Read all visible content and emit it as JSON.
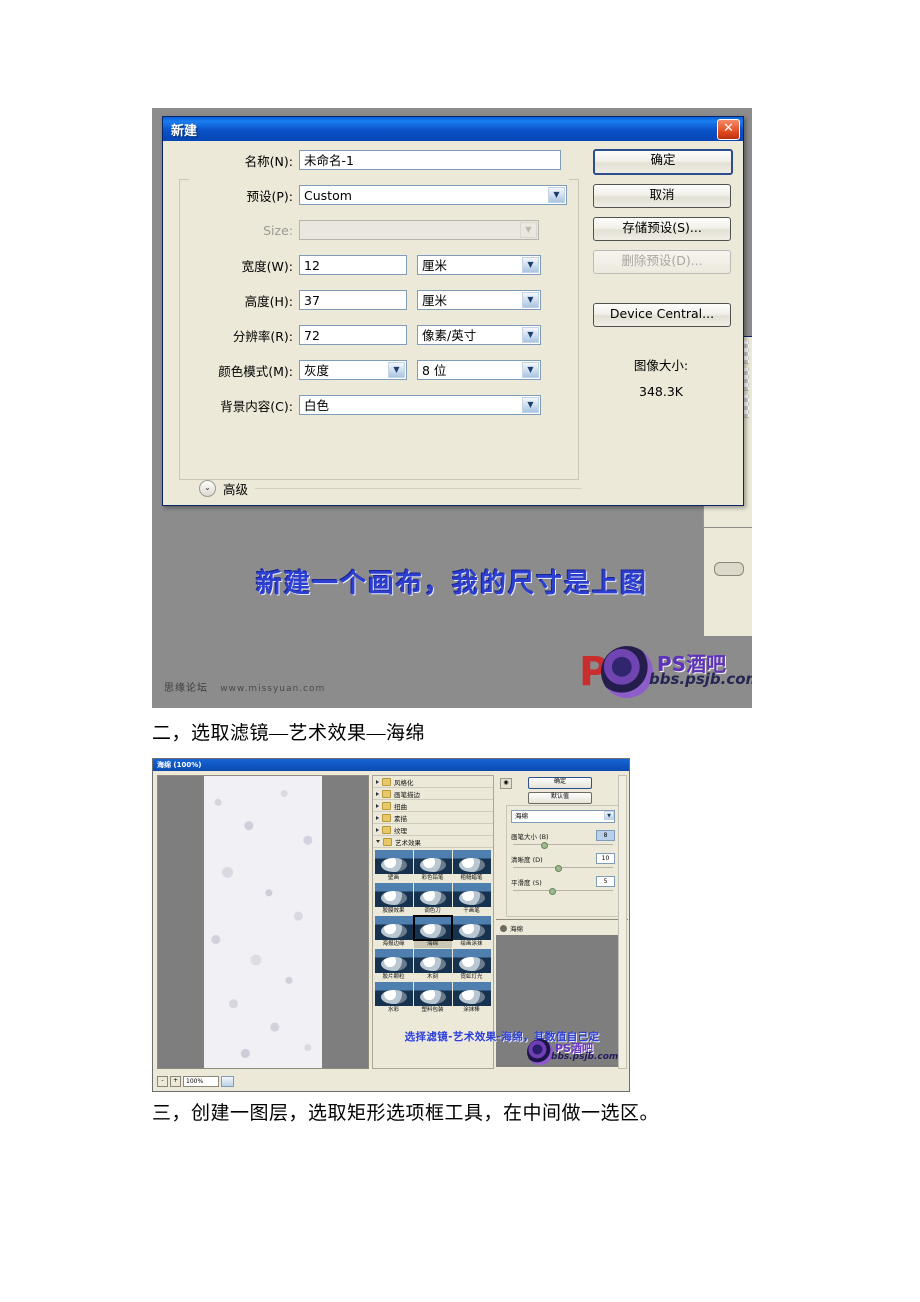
{
  "document": {
    "paragraphs": [
      {
        "id": "para-2",
        "text": "二，选取滤镜—艺术效果—海绵"
      },
      {
        "id": "para-3",
        "text": "三，创建一图层，选取矩形选项框工具，在中间做一选区。"
      }
    ]
  },
  "figure1": {
    "dialog": {
      "title": "新建",
      "close_label": "✕",
      "fields": {
        "name": {
          "label": "名称(N):",
          "value": "未命名-1"
        },
        "preset": {
          "label": "预设(P):",
          "value": "Custom"
        },
        "size": {
          "label": "Size:",
          "value": "",
          "disabled": true
        },
        "width": {
          "label": "宽度(W):",
          "value": "12",
          "unit": "厘米"
        },
        "height": {
          "label": "高度(H):",
          "value": "37",
          "unit": "厘米"
        },
        "resolution": {
          "label": "分辨率(R):",
          "value": "72",
          "unit": "像素/英寸"
        },
        "color_mode": {
          "label": "颜色模式(M):",
          "value": "灰度",
          "depth": "8 位"
        },
        "background": {
          "label": "背景内容(C):",
          "value": "白色"
        }
      },
      "advanced": {
        "label": "高级",
        "chevron": "⌄"
      },
      "buttons": {
        "ok": "确定",
        "cancel": "取消",
        "save_preset": "存储预设(S)...",
        "delete_preset": "删除预设(D)...",
        "device_central": "Device Central..."
      },
      "image_size": {
        "label": "图像大小:",
        "value": "348.3K"
      }
    },
    "caption": "新建一个画布，我的尺寸是上图",
    "watermark_left": {
      "name": "思缘论坛",
      "site": "www.missyuan.com"
    },
    "watermark_right": {
      "mark": "P",
      "title": "PS酒吧",
      "sub": "bbs.psjb.com"
    }
  },
  "figure2": {
    "title": "海绵 (100%)",
    "zoom": {
      "minus": "-",
      "plus": "+",
      "value": "100%"
    },
    "tree": [
      {
        "label": "风格化",
        "open": false
      },
      {
        "label": "画笔描边",
        "open": false
      },
      {
        "label": "扭曲",
        "open": false
      },
      {
        "label": "素描",
        "open": false
      },
      {
        "label": "纹理",
        "open": false
      },
      {
        "label": "艺术效果",
        "open": true
      }
    ],
    "thumbnails": [
      {
        "label": "壁画",
        "selected": false
      },
      {
        "label": "彩色铅笔",
        "selected": false
      },
      {
        "label": "粗糙蜡笔",
        "selected": false
      },
      {
        "label": "胶膜效果",
        "selected": false
      },
      {
        "label": "调色刀",
        "selected": false
      },
      {
        "label": "干画笔",
        "selected": false
      },
      {
        "label": "海报边缘",
        "selected": false
      },
      {
        "label": "海绵",
        "selected": true
      },
      {
        "label": "绘画涂抹",
        "selected": false
      },
      {
        "label": "胶片颗粒",
        "selected": false
      },
      {
        "label": "木刻",
        "selected": false
      },
      {
        "label": "霓虹灯光",
        "selected": false
      },
      {
        "label": "水彩",
        "selected": false
      },
      {
        "label": "塑料包装",
        "selected": false
      },
      {
        "label": "涂抹棒",
        "selected": false
      }
    ],
    "settings": {
      "ok": "确定",
      "default": "默认值",
      "filter_name": "海绵",
      "sliders": [
        {
          "label": "画笔大小 (B)",
          "value": "8"
        },
        {
          "label": "清晰度 (D)",
          "value": "10"
        },
        {
          "label": "平滑度 (S)",
          "value": "5"
        }
      ]
    },
    "layer_row": "海绵",
    "caption": "选择滤镜-艺术效果-海绵，其数值自己定",
    "watermark": {
      "title": "PS酒吧",
      "sub": "bbs.psjb.com"
    }
  }
}
